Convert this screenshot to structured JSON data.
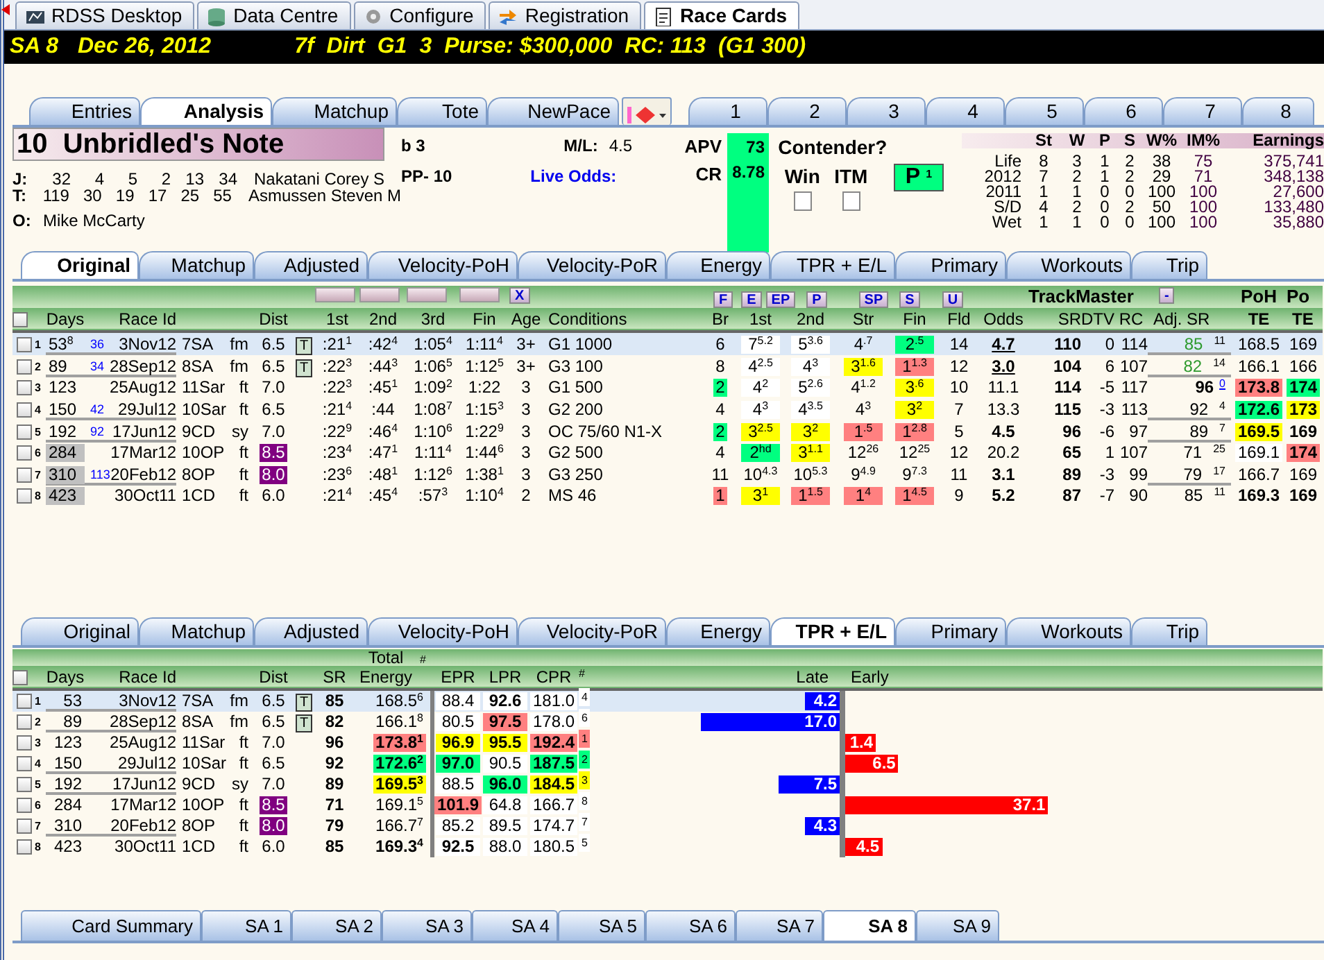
{
  "app_tabs": [
    {
      "label": "RDSS Desktop",
      "selected": false
    },
    {
      "label": "Data Centre",
      "selected": false
    },
    {
      "label": "Configure",
      "selected": false
    },
    {
      "label": "Registration",
      "selected": false
    },
    {
      "label": "Race Cards",
      "selected": true
    }
  ],
  "race_header": {
    "card": "SA 8",
    "date": "Dec 26, 2012",
    "details": [
      "7f",
      "Dirt",
      "G1",
      "3",
      "Purse: $300,000",
      "RC: 113",
      "(G1 300)"
    ]
  },
  "view_tabs": [
    {
      "label": "Entries",
      "selected": false
    },
    {
      "label": "Analysis",
      "selected": true
    },
    {
      "label": "Matchup",
      "selected": false
    },
    {
      "label": "Tote",
      "selected": false
    },
    {
      "label": "NewPace",
      "selected": false
    }
  ],
  "program_tabs": [
    {
      "label": "1",
      "selected": false
    },
    {
      "label": "2",
      "selected": false
    },
    {
      "label": "3",
      "selected": false
    },
    {
      "label": "4",
      "selected": false
    },
    {
      "label": "5",
      "selected": false
    },
    {
      "label": "6",
      "selected": false
    },
    {
      "label": "7",
      "selected": false
    },
    {
      "label": "8",
      "selected": false
    }
  ],
  "horse": {
    "number": "10",
    "name": "Unbridled's Note",
    "sex_age": "b  3",
    "post": "PP- 10",
    "ml_label": "M/L:",
    "ml": "4.5",
    "live_odds_label": "Live Odds:",
    "apv_label": "APV",
    "apv": "73",
    "cr_label": "CR",
    "cr": "8.78",
    "people": [
      {
        "label": "J:",
        "stats": [
          "32",
          "4",
          "5",
          "2",
          "13",
          "34"
        ],
        "name": "Nakatani Corey S"
      },
      {
        "label": "T:",
        "stats": [
          "119",
          "30",
          "19",
          "17",
          "25",
          "55"
        ],
        "name": "Asmussen Steven M"
      },
      {
        "label": "O:",
        "name": "Mike McCarty"
      }
    ]
  },
  "contender": {
    "title": "Contender?",
    "options": [
      {
        "label": "Win",
        "checked": false
      },
      {
        "label": "ITM",
        "checked": false
      }
    ],
    "pick": "P $^{1}$"
  },
  "record": {
    "columns": [
      "St",
      "W",
      "P",
      "S",
      "W%",
      "IM%",
      "Earnings"
    ],
    "rows": [
      {
        "label": "Life",
        "values": [
          "8",
          "3",
          "1",
          "2",
          "38",
          "75",
          "375,741"
        ]
      },
      {
        "label": "2012",
        "values": [
          "7",
          "2",
          "1",
          "2",
          "29",
          "71",
          "348,138"
        ]
      },
      {
        "label": "2011",
        "values": [
          "1",
          "1",
          "0",
          "0",
          "100",
          "100",
          "27,600"
        ]
      },
      {
        "label": "S/D",
        "values": [
          "4",
          "2",
          "0",
          "2",
          "50",
          "100",
          "133,480"
        ]
      },
      {
        "label": "Wet",
        "values": [
          "1",
          "1",
          "0",
          "0",
          "100",
          "100",
          "35,880"
        ]
      }
    ]
  },
  "pp_tabs": [
    {
      "label": "Original",
      "selected": true
    },
    {
      "label": "Matchup",
      "selected": false
    },
    {
      "label": "Adjusted",
      "selected": false
    },
    {
      "label": "Velocity-PoH",
      "selected": false
    },
    {
      "label": "Velocity-PoR",
      "selected": false
    },
    {
      "label": "Energy",
      "selected": false
    },
    {
      "label": "TPR + E/L",
      "selected": false
    },
    {
      "label": "Primary",
      "selected": false
    },
    {
      "label": "Workouts",
      "selected": false
    },
    {
      "label": "Trip",
      "selected": false
    }
  ],
  "pp_table": {
    "header_checked": false,
    "clear_button": "X",
    "filter_buttons": [
      "F",
      "E",
      "EP",
      "P",
      "SP",
      "S",
      "U"
    ],
    "group_label": "TrackMaster",
    "collapse_button": "-",
    "columns": {
      "days": "Days",
      "race_id": "Race Id",
      "dist": "Dist",
      "f1": "1st",
      "f2": "2nd",
      "f3": "3rd",
      "fin": "Fin",
      "age": "Age",
      "cond": "Conditions",
      "br": "Br",
      "call_1st": "1st",
      "call_2nd": "2nd",
      "call_str": "Str",
      "call_fin": "Fin",
      "fld": "Fld",
      "odds": "Odds",
      "sr": "SR",
      "dtv": "DTV",
      "rc": "RC",
      "adj": "Adj. SR",
      "poh": [
        "PoH",
        "TE"
      ],
      "por": [
        "Po",
        "TE"
      ]
    },
    "rows": [
      {
        "n": "1",
        "checked": false,
        "selected": true,
        "underlined": true,
        "days": "53$^{8}$",
        "days_shaded": false,
        "days_note": "36",
        "date": "3Nov12",
        "race": "7SA",
        "surface": "fm",
        "dist": "6.5",
        "dist_long": false,
        "tag": "T",
        "f1": ":21$^{1}$",
        "f2": ":42$^{4}$",
        "f3": "1:05$^{4}$",
        "fin": "1:11$^{4}$",
        "age": "3+",
        "cond": "G1 1000",
        "br": {
          "t": "6"
        },
        "call_1st": {
          "t": "7$^{5.2}$",
          "color": "#ffffff"
        },
        "call_2nd": {
          "t": "5$^{3.6}$",
          "color": "#ffffff"
        },
        "call_str": {
          "t": "4$^{.7}$"
        },
        "call_fin": {
          "t": "2$^{.5}$",
          "color": "#00ff80"
        },
        "fld": "14",
        "odds": {
          "t": "4.7",
          "kind": "favorite"
        },
        "sr": "110",
        "dtv": "0",
        "rc": "114",
        "adj": {
          "t": "85",
          "note": "11",
          "kind": "accent"
        },
        "poh": {
          "t": "168.5",
          "bold": false
        },
        "por": {
          "t": "169",
          "bold": false
        }
      },
      {
        "n": "2",
        "checked": false,
        "selected": false,
        "underlined": true,
        "days": "89",
        "days_shaded": false,
        "days_note": "34",
        "date": "28Sep12",
        "race": "8SA",
        "surface": "fm",
        "dist": "6.5",
        "dist_long": false,
        "tag": "T",
        "f1": ":22$^{3}$",
        "f2": ":44$^{3}$",
        "f3": "1:06$^{5}$",
        "fin": "1:12$^{5}$",
        "age": "3+",
        "cond": "G3 100",
        "br": {
          "t": "8"
        },
        "call_1st": {
          "t": "4$^{2.5}$",
          "color": "#ffffff"
        },
        "call_2nd": {
          "t": "4$^{3}$",
          "color": "#ffffff"
        },
        "call_str": {
          "t": "3$^{1.6}$",
          "color": "#ffff00"
        },
        "call_fin": {
          "t": "1$^{1.3}$",
          "color": "#ff8080"
        },
        "fld": "12",
        "odds": {
          "t": "3.0",
          "kind": "favorite"
        },
        "sr": "104",
        "dtv": "6",
        "rc": "107",
        "adj": {
          "t": "82",
          "note": "14",
          "kind": "accent"
        },
        "poh": {
          "t": "166.1",
          "bold": false
        },
        "por": {
          "t": "166",
          "bold": false
        }
      },
      {
        "n": "3",
        "checked": false,
        "selected": false,
        "underlined": false,
        "days": "123",
        "days_shaded": false,
        "date": "25Aug12",
        "race": "11Sar",
        "surface": "ft",
        "dist": "7.0",
        "dist_long": false,
        "f1": ":22$^{3}$",
        "f2": ":45$^{1}$",
        "f3": "1:09$^{2}$",
        "fin": "1:22",
        "age": "3",
        "cond": "G1 500",
        "br": {
          "t": "2",
          "color": "#00ff80"
        },
        "call_1st": {
          "t": "4$^{2}$",
          "color": "#ffffff"
        },
        "call_2nd": {
          "t": "5$^{2.6}$",
          "color": "#ffffff"
        },
        "call_str": {
          "t": "4$^{1.2}$"
        },
        "call_fin": {
          "t": "3$^{.6}$",
          "color": "#ffff00"
        },
        "fld": "10",
        "odds": {
          "t": "11.1",
          "kind": "plain"
        },
        "sr": "114",
        "dtv": "-5",
        "rc": "117",
        "adj": {
          "t": "96",
          "note": "0",
          "kind": "strong"
        },
        "poh": {
          "t": "173.8",
          "color": "#ff8080",
          "bold": true
        },
        "por": {
          "t": "174",
          "color": "#00ff80",
          "bold": true
        }
      },
      {
        "n": "4",
        "checked": false,
        "selected": false,
        "underlined": true,
        "days": "150",
        "days_shaded": false,
        "days_note": "42",
        "date": "29Jul12",
        "race": "10Sar",
        "surface": "ft",
        "dist": "6.5",
        "dist_long": false,
        "f1": ":21$^{4}$",
        "f2": ":44",
        "f3": "1:08$^{7}$",
        "fin": "1:15$^{3}$",
        "age": "3",
        "cond": "G2 200",
        "br": {
          "t": "4"
        },
        "call_1st": {
          "t": "4$^{3}$",
          "color": "#ffffff"
        },
        "call_2nd": {
          "t": "4$^{3.5}$",
          "color": "#ffffff"
        },
        "call_str": {
          "t": "4$^{3}$"
        },
        "call_fin": {
          "t": "3$^{2}$",
          "color": "#ffff00"
        },
        "fld": "7",
        "odds": {
          "t": "13.3",
          "kind": "plain"
        },
        "sr": "115",
        "dtv": "-3",
        "rc": "113",
        "adj": {
          "t": "92",
          "note": "4",
          "kind": "plain"
        },
        "poh": {
          "t": "172.6",
          "color": "#00ff80",
          "bold": true
        },
        "por": {
          "t": "173",
          "color": "#ffff00",
          "bold": true
        }
      },
      {
        "n": "5",
        "checked": false,
        "selected": false,
        "underlined": true,
        "days": "192",
        "days_shaded": false,
        "days_note": "92",
        "date": "17Jun12",
        "race": "9CD",
        "surface": "sy",
        "dist": "7.0",
        "dist_long": false,
        "f1": ":22$^{9}$",
        "f2": ":46$^{4}$",
        "f3": "1:10$^{6}$",
        "fin": "1:22$^{9}$",
        "age": "3",
        "cond": "OC 75/60 N1-X",
        "br": {
          "t": "2",
          "color": "#00ff80"
        },
        "call_1st": {
          "t": "3$^{2.5}$",
          "color": "#ffff00"
        },
        "call_2nd": {
          "t": "3$^{2}$",
          "color": "#ffff00"
        },
        "call_str": {
          "t": "1$^{.5}$",
          "color": "#ff8080"
        },
        "call_fin": {
          "t": "1$^{2.8}$",
          "color": "#ff8080"
        },
        "fld": "5",
        "odds": {
          "t": "4.5",
          "kind": "strong"
        },
        "sr": "96",
        "dtv": "-6",
        "rc": "97",
        "adj": {
          "t": "89",
          "note": "7",
          "kind": "plain"
        },
        "poh": {
          "t": "169.5",
          "color": "#ffff00",
          "bold": true
        },
        "por": {
          "t": "169",
          "bold": true
        }
      },
      {
        "n": "6",
        "checked": false,
        "selected": false,
        "underlined": false,
        "days": "284",
        "days_shaded": true,
        "date": "17Mar12",
        "race": "10OP",
        "surface": "ft",
        "dist": "8.5",
        "dist_long": true,
        "f1": ":23$^{4}$",
        "f2": ":47$^{1}$",
        "f3": "1:11$^{4}$",
        "fin": "1:44$^{6}$",
        "age": "3",
        "cond": "G2 500",
        "br": {
          "t": "4"
        },
        "call_1st": {
          "t": "2$^{hd}$",
          "color": "#00ff80"
        },
        "call_2nd": {
          "t": "3$^{1.1}$",
          "color": "#ffff00"
        },
        "call_str": {
          "t": "12$^{26}$"
        },
        "call_fin": {
          "t": "12$^{25}$"
        },
        "fld": "12",
        "odds": {
          "t": "20.2",
          "kind": "plain"
        },
        "sr": "65",
        "dtv": "1",
        "rc": "107",
        "adj": {
          "t": "71",
          "note": "25",
          "kind": "plain"
        },
        "poh": {
          "t": "169.1",
          "color": "#ffffff",
          "bold": false
        },
        "por": {
          "t": "174",
          "color": "#ff8080",
          "bold": true
        }
      },
      {
        "n": "7",
        "checked": false,
        "selected": false,
        "underlined": true,
        "days": "310",
        "days_shaded": true,
        "days_note": "113",
        "date": "20Feb12",
        "race": "8OP",
        "surface": "ft",
        "dist": "8.0",
        "dist_long": true,
        "f1": ":23$^{6}$",
        "f2": ":48$^{1}$",
        "f3": "1:12$^{6}$",
        "fin": "1:38$^{1}$",
        "age": "3",
        "cond": "G3 250",
        "br": {
          "t": "11"
        },
        "call_1st": {
          "t": "10$^{4.3}$"
        },
        "call_2nd": {
          "t": "10$^{5.3}$"
        },
        "call_str": {
          "t": "9$^{4.9}$"
        },
        "call_fin": {
          "t": "9$^{7.3}$"
        },
        "fld": "11",
        "odds": {
          "t": "3.1",
          "kind": "strong"
        },
        "sr": "89",
        "dtv": "-3",
        "rc": "99",
        "adj": {
          "t": "79",
          "note": "17",
          "kind": "plain"
        },
        "poh": {
          "t": "166.7",
          "bold": false
        },
        "por": {
          "t": "169",
          "bold": false
        }
      },
      {
        "n": "8",
        "checked": false,
        "selected": false,
        "underlined": false,
        "days": "423",
        "days_shaded": true,
        "date": "30Oct11",
        "race": "1CD",
        "surface": "ft",
        "dist": "6.0",
        "dist_long": false,
        "f1": ":21$^{4}$",
        "f2": ":45$^{4}$",
        "f3": ":57$^{3}$",
        "fin": "1:10$^{4}$",
        "age": "2",
        "cond": "MS 46",
        "br": {
          "t": "1",
          "color": "#ff8080"
        },
        "call_1st": {
          "t": "3$^{1}$",
          "color": "#ffff00"
        },
        "call_2nd": {
          "t": "1$^{1.5}$",
          "color": "#ff8080"
        },
        "call_str": {
          "t": "1$^{4}$",
          "color": "#ff8080"
        },
        "call_fin": {
          "t": "1$^{4.5}$",
          "color": "#ff8080"
        },
        "fld": "9",
        "odds": {
          "t": "5.2",
          "kind": "strong"
        },
        "sr": "87",
        "dtv": "-7",
        "rc": "90",
        "adj": {
          "t": "85",
          "note": "11",
          "kind": "plain"
        },
        "poh": {
          "t": "169.3",
          "bold": true
        },
        "por": {
          "t": "169",
          "bold": true
        }
      }
    ]
  },
  "energy_tabs": [
    {
      "label": "Original",
      "selected": false
    },
    {
      "label": "Matchup",
      "selected": false
    },
    {
      "label": "Adjusted",
      "selected": false
    },
    {
      "label": "Velocity-PoH",
      "selected": false
    },
    {
      "label": "Velocity-PoR",
      "selected": false
    },
    {
      "label": "Energy",
      "selected": false
    },
    {
      "label": "TPR + E/L",
      "selected": true
    },
    {
      "label": "Primary",
      "selected": false
    },
    {
      "label": "Workouts",
      "selected": false
    },
    {
      "label": "Trip",
      "selected": false
    }
  ],
  "energy_table": {
    "header_checked": false,
    "columns": {
      "days": "Days",
      "race_id": "Race Id",
      "dist": "Dist",
      "sr": "SR",
      "energy": "Total Energy",
      "energy_rank": "#",
      "epr": "EPR",
      "lpr": "LPR",
      "cpr": "CPR",
      "cpr_rank": "#",
      "late": "Late",
      "early": "Early"
    },
    "rows": [
      {
        "n": "1",
        "checked": false,
        "selected": true,
        "underlined": true,
        "days": "53",
        "date": "3Nov12",
        "race": "7SA",
        "surface": "fm",
        "dist": "6.5",
        "dist_long": false,
        "tag": "T",
        "sr": "85",
        "energy": {
          "t": "168.5$^{6}$",
          "bold": false
        },
        "epr": {
          "t": "88.4",
          "color": "#ffffff",
          "bold": false
        },
        "lpr": {
          "t": "92.6",
          "color": "#ffffff",
          "bold": true
        },
        "cpr": {
          "t": "181.0",
          "color": "#ffffff",
          "bold": false
        },
        "rank": {
          "t": "4",
          "color": "#ffffff"
        },
        "late": "4.2"
      },
      {
        "n": "2",
        "checked": false,
        "selected": false,
        "underlined": true,
        "days": "89",
        "date": "28Sep12",
        "race": "8SA",
        "surface": "fm",
        "dist": "6.5",
        "dist_long": false,
        "tag": "T",
        "sr": "82",
        "energy": {
          "t": "166.1$^{8}$",
          "bold": false
        },
        "epr": {
          "t": "80.5",
          "color": "#ffffff",
          "bold": false
        },
        "lpr": {
          "t": "97.5",
          "color": "#ff8080",
          "bold": true
        },
        "cpr": {
          "t": "178.0",
          "color": "#ffffff",
          "bold": false
        },
        "rank": {
          "t": "6",
          "color": "#ffffff"
        },
        "late": "17.0"
      },
      {
        "n": "3",
        "checked": false,
        "selected": false,
        "underlined": false,
        "days": "123",
        "date": "25Aug12",
        "race": "11Sar",
        "surface": "ft",
        "dist": "7.0",
        "dist_long": false,
        "sr": "96",
        "energy": {
          "t": "173.8$^{1}$",
          "color": "#ff8080",
          "bold": true
        },
        "epr": {
          "t": "96.9",
          "color": "#ffff00",
          "bold": true
        },
        "lpr": {
          "t": "95.5",
          "color": "#ffff00",
          "bold": true
        },
        "cpr": {
          "t": "192.4",
          "color": "#ff8080",
          "bold": true
        },
        "rank": {
          "t": "1",
          "color": "#ff8080"
        },
        "early": "1.4"
      },
      {
        "n": "4",
        "checked": false,
        "selected": false,
        "underlined": true,
        "days": "150",
        "date": "29Jul12",
        "race": "10Sar",
        "surface": "ft",
        "dist": "6.5",
        "dist_long": false,
        "sr": "92",
        "energy": {
          "t": "172.6$^{2}$",
          "color": "#00ff80",
          "bold": true
        },
        "epr": {
          "t": "97.0",
          "color": "#00ff80",
          "bold": true
        },
        "lpr": {
          "t": "90.5",
          "color": "#ffffff",
          "bold": false
        },
        "cpr": {
          "t": "187.5",
          "color": "#00ff80",
          "bold": true
        },
        "rank": {
          "t": "2",
          "color": "#00ff80"
        },
        "early": "6.5"
      },
      {
        "n": "5",
        "checked": false,
        "selected": false,
        "underlined": true,
        "days": "192",
        "date": "17Jun12",
        "race": "9CD",
        "surface": "sy",
        "dist": "7.0",
        "dist_long": false,
        "sr": "89",
        "energy": {
          "t": "169.5$^{3}$",
          "color": "#ffff00",
          "bold": true
        },
        "epr": {
          "t": "88.5",
          "color": "#ffffff",
          "bold": false
        },
        "lpr": {
          "t": "96.0",
          "color": "#00ff80",
          "bold": true
        },
        "cpr": {
          "t": "184.5",
          "color": "#ffff00",
          "bold": true
        },
        "rank": {
          "t": "3",
          "color": "#ffff00"
        },
        "late": "7.5"
      },
      {
        "n": "6",
        "checked": false,
        "selected": false,
        "underlined": false,
        "days": "284",
        "date": "17Mar12",
        "race": "10OP",
        "surface": "ft",
        "dist": "8.5",
        "dist_long": true,
        "sr": "71",
        "energy": {
          "t": "169.1$^{5}$",
          "bold": false
        },
        "epr": {
          "t": "101.9",
          "color": "#ff8080",
          "bold": true
        },
        "lpr": {
          "t": "64.8",
          "color": "#ffffff",
          "bold": false
        },
        "cpr": {
          "t": "166.7",
          "color": "#ffffff",
          "bold": false
        },
        "rank": {
          "t": "8",
          "color": "#ffffff"
        },
        "early": "37.1"
      },
      {
        "n": "7",
        "checked": false,
        "selected": false,
        "underlined": true,
        "days": "310",
        "date": "20Feb12",
        "race": "8OP",
        "surface": "ft",
        "dist": "8.0",
        "dist_long": true,
        "sr": "79",
        "energy": {
          "t": "166.7$^{7}$",
          "bold": false
        },
        "epr": {
          "t": "85.2",
          "color": "#ffffff",
          "bold": false
        },
        "lpr": {
          "t": "89.5",
          "color": "#ffffff",
          "bold": false
        },
        "cpr": {
          "t": "174.7",
          "color": "#ffffff",
          "bold": false
        },
        "rank": {
          "t": "7",
          "color": "#ffffff"
        },
        "late": "4.3"
      },
      {
        "n": "8",
        "checked": false,
        "selected": false,
        "underlined": false,
        "days": "423",
        "date": "30Oct11",
        "race": "1CD",
        "surface": "ft",
        "dist": "6.0",
        "dist_long": false,
        "sr": "85",
        "energy": {
          "t": "169.3$^{4}$",
          "bold": true
        },
        "epr": {
          "t": "92.5",
          "color": "#ffffff",
          "bold": true
        },
        "lpr": {
          "t": "88.0",
          "color": "#ffffff",
          "bold": false
        },
        "cpr": {
          "t": "180.5",
          "color": "#ffffff",
          "bold": false
        },
        "rank": {
          "t": "5",
          "color": "#ffffff"
        },
        "early": "4.5"
      }
    ]
  },
  "card_tabs": [
    {
      "label": "Card Summary",
      "selected": false
    },
    {
      "label": "SA 1",
      "selected": false
    },
    {
      "label": "SA 2",
      "selected": false
    },
    {
      "label": "SA 3",
      "selected": false
    },
    {
      "label": "SA 4",
      "selected": false
    },
    {
      "label": "SA 5",
      "selected": false
    },
    {
      "label": "SA 6",
      "selected": false
    },
    {
      "label": "SA 7",
      "selected": false
    },
    {
      "label": "SA 8",
      "selected": true
    },
    {
      "label": "SA 9",
      "selected": false
    }
  ]
}
